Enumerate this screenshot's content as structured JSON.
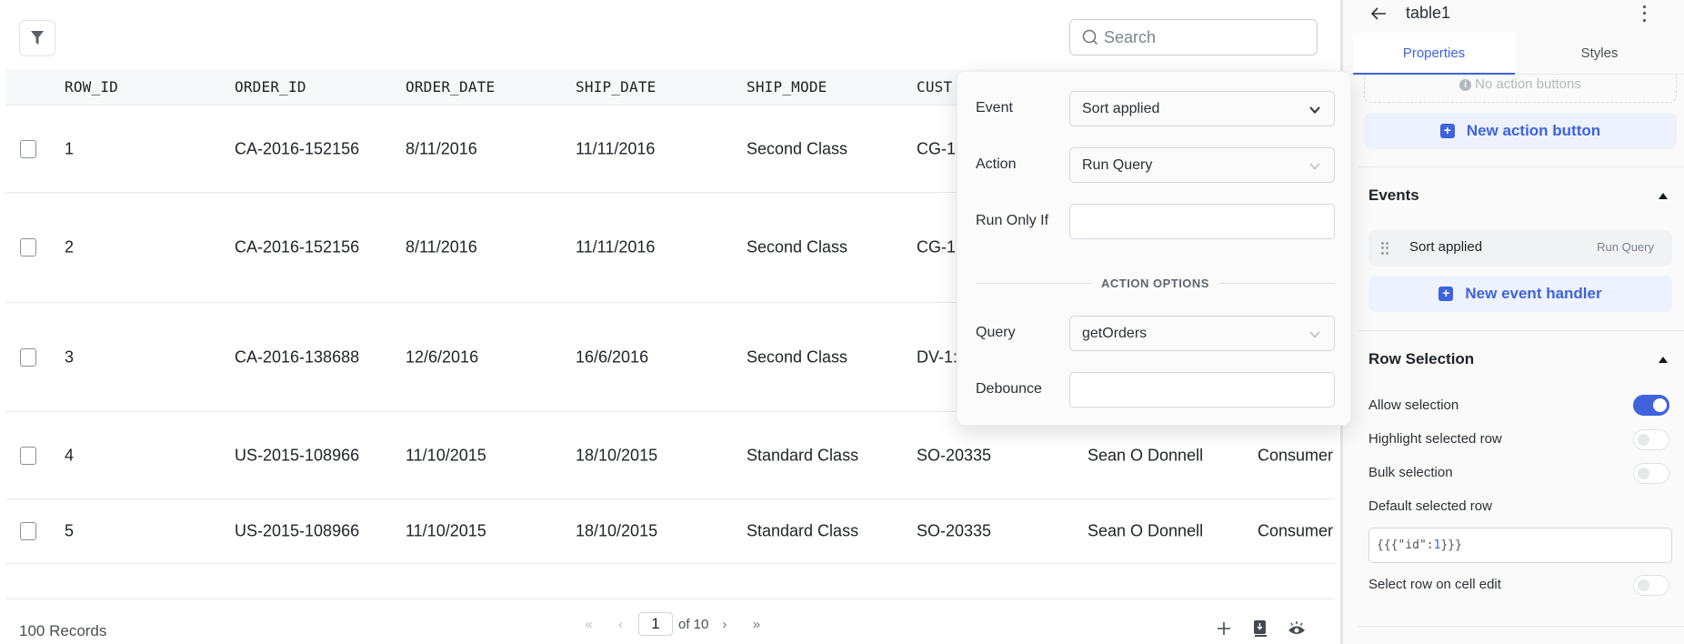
{
  "table": {
    "search_placeholder": "Search",
    "columns": [
      "ROW_ID",
      "ORDER_ID",
      "ORDER_DATE",
      "SHIP_DATE",
      "SHIP_MODE",
      "CUST"
    ],
    "rows": [
      {
        "row_id": "1",
        "order_id": "CA-2016-152156",
        "order_date": "8/11/2016",
        "ship_date": "11/11/2016",
        "ship_mode": "Second Class",
        "customer_id": "CG-1:",
        "customer_name": "",
        "segment": ""
      },
      {
        "row_id": "2",
        "order_id": "CA-2016-152156",
        "order_date": "8/11/2016",
        "ship_date": "11/11/2016",
        "ship_mode": "Second Class",
        "customer_id": "CG-1:",
        "customer_name": "",
        "segment": ""
      },
      {
        "row_id": "3",
        "order_id": "CA-2016-138688",
        "order_date": "12/6/2016",
        "ship_date": "16/6/2016",
        "ship_mode": "Second Class",
        "customer_id": "DV-1:",
        "customer_name": "",
        "segment": ""
      },
      {
        "row_id": "4",
        "order_id": "US-2015-108966",
        "order_date": "11/10/2015",
        "ship_date": "18/10/2015",
        "ship_mode": "Standard Class",
        "customer_id": "SO-20335",
        "customer_name": "Sean O Donnell",
        "segment": "Consumer"
      },
      {
        "row_id": "5",
        "order_id": "US-2015-108966",
        "order_date": "11/10/2015",
        "ship_date": "18/10/2015",
        "ship_mode": "Standard Class",
        "customer_id": "SO-20335",
        "customer_name": "Sean O Donnell",
        "segment": "Consumer"
      }
    ],
    "footer": {
      "records_label": "100 Records",
      "current_page": "1",
      "of_pages": "of 10",
      "first_icon": "«",
      "prev_icon": "‹",
      "next_icon": "›",
      "last_icon": "»"
    }
  },
  "popover": {
    "event_label": "Event",
    "event_value": "Sort applied",
    "action_label": "Action",
    "action_value": "Run Query",
    "run_only_if_label": "Run Only If",
    "run_only_if_value": "",
    "section_label": "ACTION OPTIONS",
    "query_label": "Query",
    "query_value": "getOrders",
    "debounce_label": "Debounce",
    "debounce_value": ""
  },
  "panel": {
    "title": "table1",
    "tabs": [
      "Properties",
      "Styles"
    ],
    "active_tab": "Properties",
    "no_action_buttons": "No action buttons",
    "new_action_button": "New action button",
    "events_title": "Events",
    "event_items": [
      {
        "name": "Sort applied",
        "action": "Run Query"
      }
    ],
    "new_event_handler": "New event handler",
    "row_selection_title": "Row Selection",
    "options": [
      {
        "label": "Allow selection",
        "enabled": true
      },
      {
        "label": "Highlight selected row",
        "enabled": false
      },
      {
        "label": "Bulk selection",
        "enabled": false
      }
    ],
    "default_selected_row_label": "Default selected row",
    "default_selected_row_prefix": "{{{\"id\":",
    "default_selected_row_number": "1",
    "default_selected_row_suffix": "}}}",
    "select_row_on_cell_edit_label": "Select row on cell edit",
    "select_row_on_cell_edit_enabled": false
  },
  "colors": {
    "accent": "#3e63dd",
    "accent_bg": "#edf2fe",
    "header_bg": "#f6f8fa",
    "border": "#e6e9ec"
  }
}
